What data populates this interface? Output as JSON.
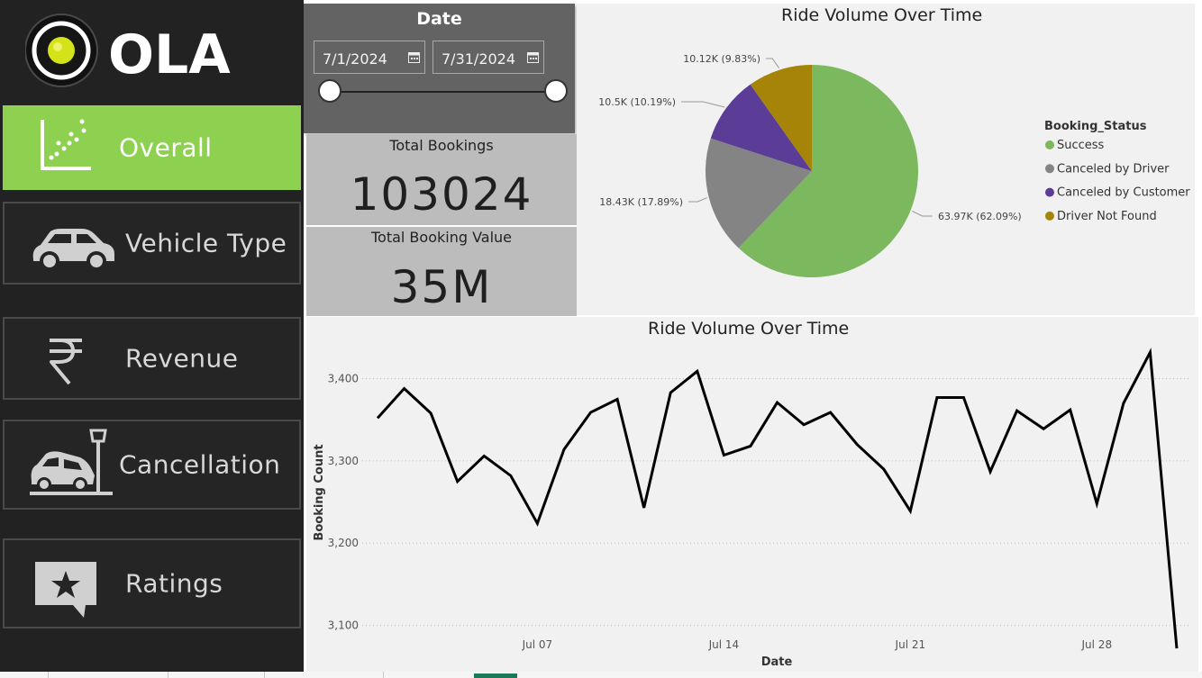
{
  "brand": {
    "name": "OLA"
  },
  "nav": [
    {
      "label": "Overall",
      "icon": "scatter-chart-icon",
      "active": true
    },
    {
      "label": "Vehicle Type",
      "icon": "car-icon",
      "active": false
    },
    {
      "label": "Revenue",
      "icon": "rupee-icon",
      "active": false
    },
    {
      "label": "Cancellation",
      "icon": "car-crash-icon",
      "active": false
    },
    {
      "label": "Ratings",
      "icon": "star-speech-bubble-icon",
      "active": false
    }
  ],
  "date_filter": {
    "title": "Date",
    "start": "7/1/2024",
    "end": "7/31/2024"
  },
  "kpis": [
    {
      "title": "Total Bookings",
      "value": "103024"
    },
    {
      "title": "Total Booking Value",
      "value": "35M"
    }
  ],
  "colors": {
    "sidebar_bg": "#222222",
    "accent": "#8ed150"
  },
  "chart_data": [
    {
      "type": "pie",
      "title": "Ride Volume Over Time",
      "legend_title": "Booking_Status",
      "legend_position": "right",
      "slices": [
        {
          "name": "Success",
          "value": 63970,
          "label": "63.97K (62.09%)",
          "color": "#7cb85d"
        },
        {
          "name": "Canceled by Driver",
          "value": 18430,
          "label": "18.43K (17.89%)",
          "color": "#848484"
        },
        {
          "name": "Canceled by Customer",
          "value": 10500,
          "label": "10.5K (10.19%)",
          "color": "#5b3c96"
        },
        {
          "name": "Driver Not Found",
          "value": 10120,
          "label": "10.12K (9.83%)",
          "color": "#a68408"
        }
      ]
    },
    {
      "type": "line",
      "title": "Ride Volume Over Time",
      "xlabel": "Date",
      "ylabel": "Booking Count",
      "ylim": [
        3070,
        3440
      ],
      "yticks": [
        "3,100",
        "3,200",
        "3,300",
        "3,400"
      ],
      "ytick_values": [
        3100,
        3200,
        3300,
        3400
      ],
      "xticks": [
        "Jul 07",
        "Jul 14",
        "Jul 21",
        "Jul 28"
      ],
      "xtick_days": [
        7,
        14,
        21,
        28
      ],
      "grid": true,
      "x": [
        "2024-07-01",
        "2024-07-02",
        "2024-07-03",
        "2024-07-04",
        "2024-07-05",
        "2024-07-06",
        "2024-07-07",
        "2024-07-08",
        "2024-07-09",
        "2024-07-10",
        "2024-07-11",
        "2024-07-12",
        "2024-07-13",
        "2024-07-14",
        "2024-07-15",
        "2024-07-16",
        "2024-07-17",
        "2024-07-18",
        "2024-07-19",
        "2024-07-20",
        "2024-07-21",
        "2024-07-22",
        "2024-07-23",
        "2024-07-24",
        "2024-07-25",
        "2024-07-26",
        "2024-07-27",
        "2024-07-28",
        "2024-07-29",
        "2024-07-30",
        "2024-07-31"
      ],
      "values": [
        3352,
        3388,
        3358,
        3275,
        3306,
        3282,
        3224,
        3314,
        3359,
        3375,
        3243,
        3383,
        3409,
        3307,
        3318,
        3371,
        3344,
        3359,
        3320,
        3290,
        3239,
        3377,
        3377,
        3287,
        3361,
        3339,
        3362,
        3248,
        3370,
        3432,
        3072
      ]
    }
  ]
}
